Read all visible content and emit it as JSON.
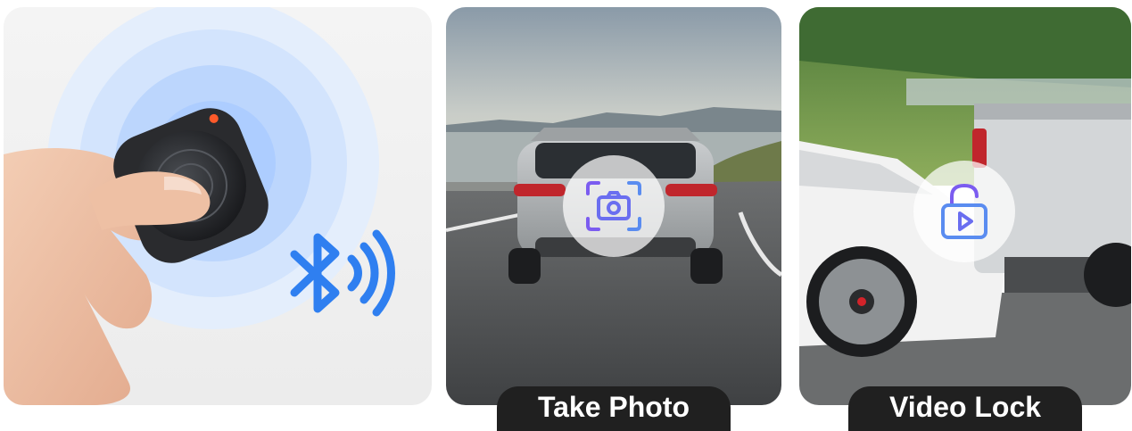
{
  "panels": [
    {
      "id": "remote",
      "caption": ""
    },
    {
      "id": "take-photo",
      "caption": "Take Photo"
    },
    {
      "id": "video-lock",
      "caption": "Video Lock"
    }
  ],
  "icons": {
    "bluetooth": "bluetooth-icon",
    "camera": "camera-scan-icon",
    "lock": "video-lock-icon"
  },
  "colors": {
    "accent_blue": "#2f7ff0",
    "icon_purple": "#7b5cf0",
    "badge_bg": "#202020",
    "badge_text": "#ffffff"
  }
}
